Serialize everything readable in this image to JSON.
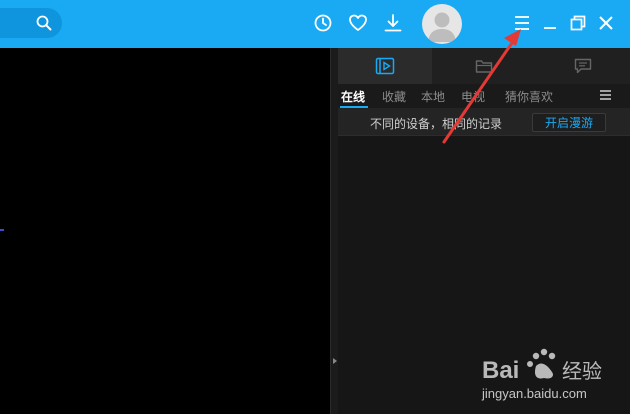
{
  "header": {
    "icons": [
      "search-icon",
      "history-icon",
      "favorite-icon",
      "download-icon",
      "avatar",
      "main-menu-icon",
      "minimize-icon",
      "restore-icon",
      "close-icon"
    ]
  },
  "panel": {
    "icon_tabs": [
      "playlist-icon",
      "folder-icon",
      "chat-icon"
    ],
    "tabs": [
      {
        "label": "在线",
        "active": true
      },
      {
        "label": "收藏"
      },
      {
        "label": "本地"
      },
      {
        "label": "电视"
      },
      {
        "label": "猜你喜欢"
      }
    ],
    "sync_text": "不同的设备，相同的记录",
    "sync_button": "开启漫游"
  },
  "watermark": {
    "logo": "Bai 经验",
    "url": "jingyan.baidu.com"
  },
  "colors": {
    "accent": "#1aa9f3",
    "annotation": "#e53935"
  }
}
